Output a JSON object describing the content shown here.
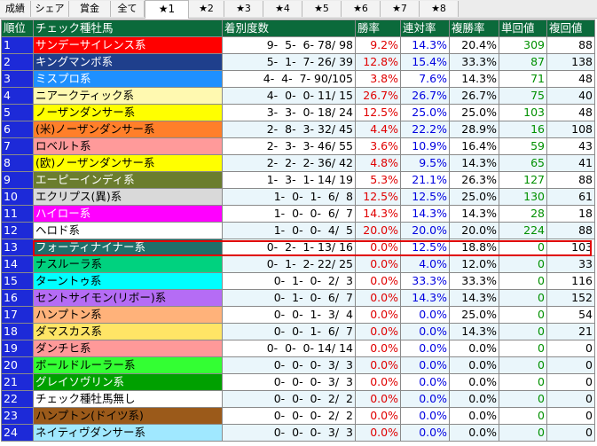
{
  "tabs": [
    {
      "label": "成績"
    },
    {
      "label": "シェア"
    },
    {
      "label": "賞金"
    },
    {
      "label": "全て"
    },
    {
      "label": "★1"
    },
    {
      "label": "★2"
    },
    {
      "label": "★3"
    },
    {
      "label": "★4"
    },
    {
      "label": "★5"
    },
    {
      "label": "★6"
    },
    {
      "label": "★7"
    },
    {
      "label": "★8"
    }
  ],
  "table": {
    "headers": [
      "順位",
      "チェック種牡馬",
      "着別度数",
      "勝率",
      "連対率",
      "複勝率",
      "単回値",
      "複回値"
    ],
    "rows": [
      {
        "rank": "1",
        "sire": "サンデーサイレンス系",
        "color": "#ff0000",
        "text": "#ffffff",
        "record": "9-  5-  6- 78/ 98",
        "win": "9.2%",
        "quin": "14.3%",
        "show": "20.4%",
        "wr": "309",
        "sr": "88"
      },
      {
        "rank": "2",
        "sire": "キングマンボ系",
        "color": "#1f3f8c",
        "text": "#ffffff",
        "record": "5-  1-  7- 26/ 39",
        "win": "12.8%",
        "quin": "15.4%",
        "show": "33.3%",
        "wr": "87",
        "sr": "138"
      },
      {
        "rank": "3",
        "sire": "ミスプロ系",
        "color": "#1e90ff",
        "text": "#ffffff",
        "record": "4-  4-  7- 90/105",
        "win": "3.8%",
        "quin": "7.6%",
        "show": "14.3%",
        "wr": "71",
        "sr": "48"
      },
      {
        "rank": "4",
        "sire": "ニアークティック系",
        "color": "#fff9b0",
        "text": "#000000",
        "record": "4-  0-  0- 11/ 15",
        "win": "26.7%",
        "quin": "26.7%",
        "show": "26.7%",
        "wr": "75",
        "sr": "40"
      },
      {
        "rank": "5",
        "sire": "ノーザンダンサー系",
        "color": "#ffff00",
        "text": "#000000",
        "record": "3-  3-  0- 18/ 24",
        "win": "12.5%",
        "quin": "25.0%",
        "show": "25.0%",
        "wr": "103",
        "sr": "48"
      },
      {
        "rank": "6",
        "sire": "(米)ノーザンダンサー系",
        "color": "#ff7f2a",
        "text": "#000000",
        "record": "2-  8-  3- 32/ 45",
        "win": "4.4%",
        "quin": "22.2%",
        "show": "28.9%",
        "wr": "16",
        "sr": "108"
      },
      {
        "rank": "7",
        "sire": "ロベルト系",
        "color": "#ff9a9a",
        "text": "#000000",
        "record": "2-  3-  3- 46/ 55",
        "win": "3.6%",
        "quin": "10.9%",
        "show": "16.4%",
        "wr": "59",
        "sr": "43"
      },
      {
        "rank": "8",
        "sire": "(欧)ノーザンダンサー系",
        "color": "#ffff00",
        "text": "#000000",
        "record": "2-  2-  2- 36/ 42",
        "win": "4.8%",
        "quin": "9.5%",
        "show": "14.3%",
        "wr": "65",
        "sr": "41"
      },
      {
        "rank": "9",
        "sire": "エーピーインディ系",
        "color": "#6b7d2e",
        "text": "#ffffff",
        "record": "1-  3-  1- 14/ 19",
        "win": "5.3%",
        "quin": "21.1%",
        "show": "26.3%",
        "wr": "127",
        "sr": "88"
      },
      {
        "rank": "10",
        "sire": "エクリプス(異)系",
        "color": "#d9d9d9",
        "text": "#000000",
        "record": "1-  0-  1-  6/  8",
        "win": "12.5%",
        "quin": "12.5%",
        "show": "25.0%",
        "wr": "130",
        "sr": "61"
      },
      {
        "rank": "11",
        "sire": "ハイロー系",
        "color": "#ff00ff",
        "text": "#ffffff",
        "record": "1-  0-  0-  6/  7",
        "win": "14.3%",
        "quin": "14.3%",
        "show": "14.3%",
        "wr": "28",
        "sr": "18"
      },
      {
        "rank": "12",
        "sire": "ヘロド系",
        "color": "#ffffff",
        "text": "#000000",
        "record": "1-  0-  0-  4/  5",
        "win": "20.0%",
        "quin": "20.0%",
        "show": "20.0%",
        "wr": "224",
        "sr": "88"
      },
      {
        "rank": "13",
        "sire": "フォーティナイナー系",
        "color": "#1f6f6a",
        "text": "#ffffff",
        "record": "0-  2-  1- 13/ 16",
        "win": "0.0%",
        "quin": "12.5%",
        "show": "18.8%",
        "wr": "0",
        "sr": "103"
      },
      {
        "rank": "14",
        "sire": "ナスルーラ系",
        "color": "#00d27f",
        "text": "#000000",
        "record": "0-  1-  2- 22/ 25",
        "win": "0.0%",
        "quin": "4.0%",
        "show": "12.0%",
        "wr": "0",
        "sr": "33"
      },
      {
        "rank": "15",
        "sire": "ターントゥ系",
        "color": "#00ffff",
        "text": "#000000",
        "record": "0-  1-  0-  2/  3",
        "win": "0.0%",
        "quin": "33.3%",
        "show": "33.3%",
        "wr": "0",
        "sr": "116"
      },
      {
        "rank": "16",
        "sire": "セントサイモン(リボー)系",
        "color": "#b56cf5",
        "text": "#000000",
        "record": "0-  1-  0-  6/  7",
        "win": "0.0%",
        "quin": "14.3%",
        "show": "14.3%",
        "wr": "0",
        "sr": "152"
      },
      {
        "rank": "17",
        "sire": "ハンプトン系",
        "color": "#ffb27a",
        "text": "#000000",
        "record": "0-  0-  1-  3/  4",
        "win": "0.0%",
        "quin": "0.0%",
        "show": "25.0%",
        "wr": "0",
        "sr": "54"
      },
      {
        "rank": "18",
        "sire": "ダマスカス系",
        "color": "#ffe566",
        "text": "#000000",
        "record": "0-  0-  1-  6/  7",
        "win": "0.0%",
        "quin": "0.0%",
        "show": "14.3%",
        "wr": "0",
        "sr": "21"
      },
      {
        "rank": "19",
        "sire": "ダンチヒ系",
        "color": "#ff9999",
        "text": "#000000",
        "record": "0-  0-  0- 14/ 14",
        "win": "0.0%",
        "quin": "0.0%",
        "show": "0.0%",
        "wr": "0",
        "sr": "0"
      },
      {
        "rank": "20",
        "sire": "ボールドルーラー系",
        "color": "#33ff33",
        "text": "#000000",
        "record": "0-  0-  0-  3/  3",
        "win": "0.0%",
        "quin": "0.0%",
        "show": "0.0%",
        "wr": "0",
        "sr": "0"
      },
      {
        "rank": "21",
        "sire": "グレイソヴリン系",
        "color": "#00a000",
        "text": "#ffffff",
        "record": "0-  0-  0-  3/  3",
        "win": "0.0%",
        "quin": "0.0%",
        "show": "0.0%",
        "wr": "0",
        "sr": "0"
      },
      {
        "rank": "22",
        "sire": "チェック種牡馬無し",
        "color": "#ffffff",
        "text": "#000000",
        "record": "0-  0-  0-  2/  2",
        "win": "0.0%",
        "quin": "0.0%",
        "show": "0.0%",
        "wr": "0",
        "sr": "0"
      },
      {
        "rank": "23",
        "sire": "ハンプトン(ドイツ系)",
        "color": "#9b5a1a",
        "text": "#000000",
        "record": "0-  0-  0-  2/  2",
        "win": "0.0%",
        "quin": "0.0%",
        "show": "0.0%",
        "wr": "0",
        "sr": "0"
      },
      {
        "rank": "24",
        "sire": "ネイティヴダンサー系",
        "color": "#a0e8ff",
        "text": "#000000",
        "record": "0-  0-  0-  3/  3",
        "win": "0.0%",
        "quin": "0.0%",
        "show": "0.0%",
        "wr": "0",
        "sr": "0"
      }
    ],
    "highlighted_rank": "13"
  },
  "colors": {
    "header_bg": "#0b6a3b",
    "rank_bg": "#1d2ad8",
    "win_color": "#e00000",
    "quinella_color": "#0000e0",
    "win_return_color": "#009000",
    "highlight": "#e00000"
  }
}
